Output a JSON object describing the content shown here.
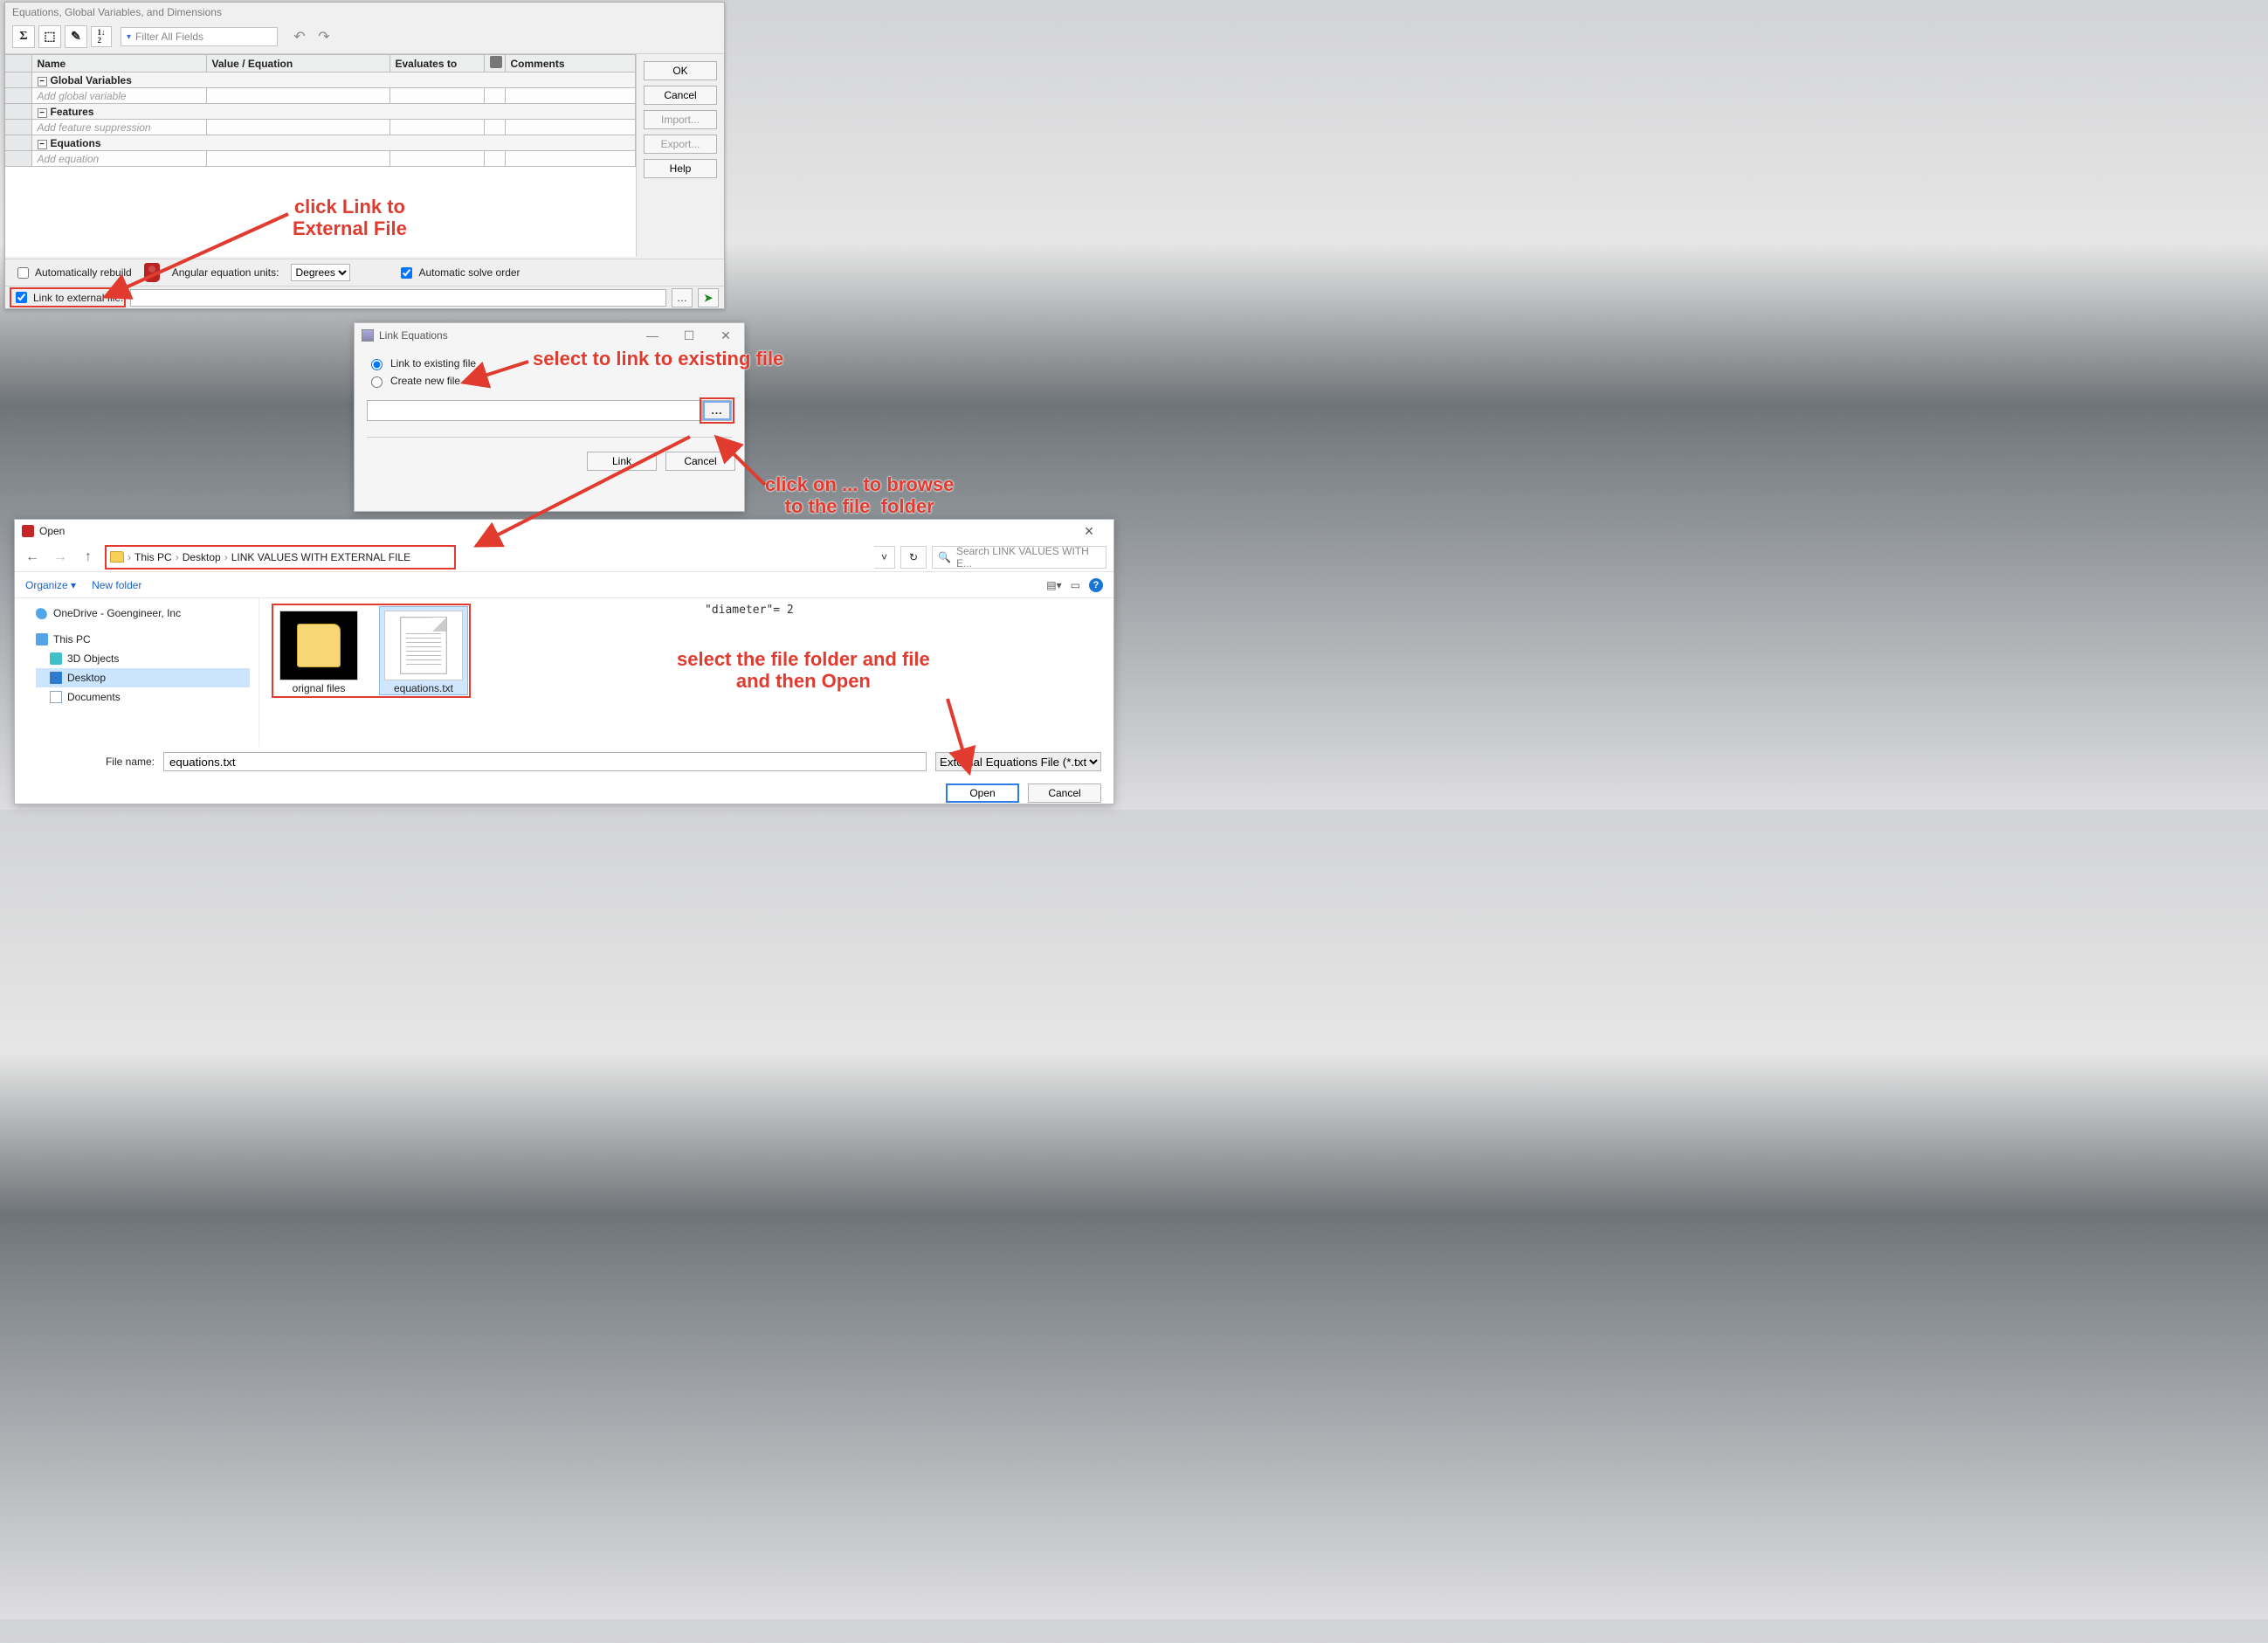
{
  "eq": {
    "title": "Equations, Global Variables, and Dimensions",
    "filter_placeholder": "Filter All Fields",
    "columns": {
      "name": "Name",
      "value": "Value / Equation",
      "eval": "Evaluates to",
      "comments": "Comments"
    },
    "sections": {
      "globals": {
        "label": "Global Variables",
        "placeholder": "Add global variable"
      },
      "features": {
        "label": "Features",
        "placeholder": "Add feature suppression"
      },
      "equations": {
        "label": "Equations",
        "placeholder": "Add equation"
      }
    },
    "buttons": {
      "ok": "OK",
      "cancel": "Cancel",
      "import": "Import...",
      "export": "Export...",
      "help": "Help"
    },
    "auto_rebuild": "Automatically rebuild",
    "angular_label": "Angular equation units:",
    "angular_value": "Degrees",
    "auto_solve": "Automatic solve order",
    "link_label": "Link to external file:",
    "link_checked": true
  },
  "le": {
    "title": "Link Equations",
    "opt1": "Link to existing file",
    "opt2": "Create new file",
    "browse": "...",
    "link": "Link",
    "cancel": "Cancel"
  },
  "open": {
    "title": "Open",
    "crumbs": [
      "This PC",
      "Desktop",
      "LINK VALUES WITH EXTERNAL FILE"
    ],
    "search_placeholder": "Search LINK VALUES WITH E...",
    "organize": "Organize",
    "newfolder": "New folder",
    "tree": {
      "onedrive": "OneDrive - Goengineer, Inc",
      "thispc": "This PC",
      "objects3d": "3D Objects",
      "desktop": "Desktop",
      "documents": "Documents"
    },
    "files": {
      "folder": "orignal files",
      "txt": "equations.txt"
    },
    "preview": "\"diameter\"= 2",
    "filename_label": "File name:",
    "filename_value": "equations.txt",
    "filter": "External Equations File (*.txt)",
    "open_btn": "Open",
    "cancel": "Cancel"
  },
  "annot": {
    "a1": "click Link to\nExternal File",
    "a2": "select to link to existing file",
    "a3": "click on ... to browse\nto the file  folder",
    "a4": "select the file folder and file\nand then Open"
  }
}
